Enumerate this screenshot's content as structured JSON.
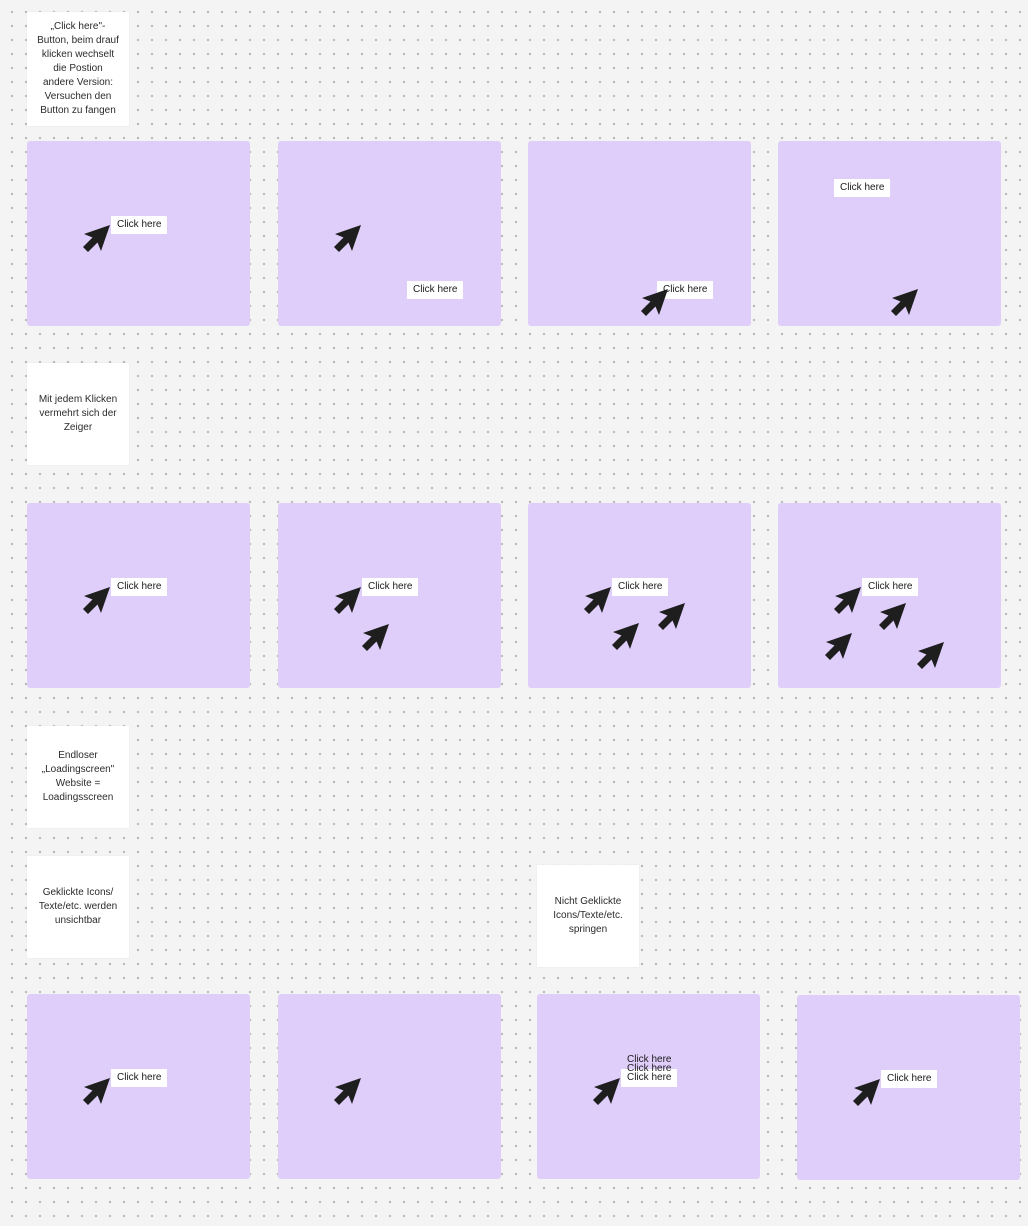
{
  "colors": {
    "background": "#f4f4f4",
    "frame": "#dfcefa",
    "cursor": "#1e1e1e",
    "note": "#ffffff"
  },
  "cursor_icon": "arrow-cursor-icon",
  "notes": {
    "n1": "„Click here\"-\nButton, beim drauf\nklicken wechselt\ndie Postion\nandere Version:\nVersuchen den\nButton zu fangen",
    "n2": "Mit jedem Klicken\nvermehrt sich der\nZeiger",
    "n3": "Endloser\n„Loadingscreen\"\nWebsite =\nLoadingsscreen",
    "n4": "Geklickte Icons/\nTexte/etc. werden\nunsichtbar",
    "n5": "Nicht Geklickte\nIcons/Texte/etc.\nspringen"
  },
  "button_label": "Click here",
  "button_label_overlap_1": "Click here",
  "button_label_overlap_2": "Click here"
}
